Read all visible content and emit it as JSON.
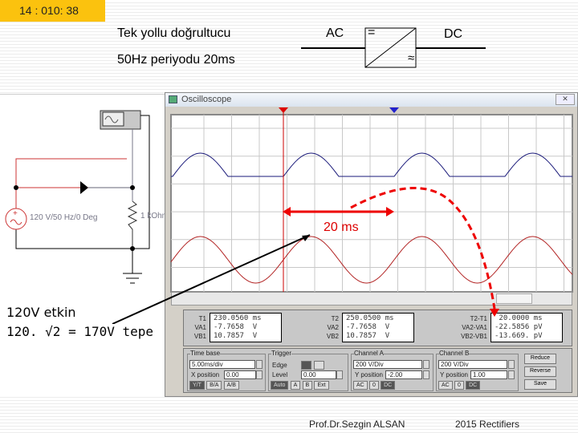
{
  "slide": {
    "number": "14 : 010: 38",
    "title": "Tek yollu doğrultucu",
    "subtitle": "50Hz periyodu 20ms",
    "ac_label": "AC",
    "dc_label": "DC",
    "dc_symbol": "=",
    "ac_symbol": "≈"
  },
  "circuit": {
    "source_label": "120 V/50 Hz/0 Deg",
    "resistor_label": "1 kOhm"
  },
  "notes": {
    "rms": "120V etkin",
    "peak": "120. √2 = 170V tepe",
    "period_label": "20 ms"
  },
  "oscilloscope": {
    "title": "Oscilloscope",
    "close": "✕",
    "cursor1": "1",
    "cursor2": "2",
    "measurements": [
      {
        "labels": [
          "T1",
          "VA1",
          "VB1"
        ],
        "values": [
          "230.0560 ms",
          "-7.7658  V",
          "10.7857  V"
        ]
      },
      {
        "labels": [
          "T2",
          "VA2",
          "VB2"
        ],
        "values": [
          "250.0500 ms",
          "-7.7658  V",
          "10.7857  V"
        ]
      },
      {
        "labels": [
          "T2-T1",
          "VA2-VA1",
          "VB2-VB1"
        ],
        "values": [
          " 20.0000 ms",
          "-22.5856 pV",
          "-13.669. pV"
        ]
      }
    ],
    "timebase": {
      "title": "Time base",
      "scale": "5.00ms/div",
      "xpos_label": "X position",
      "xpos": "0.00",
      "buttons": [
        "Y/T",
        "B/A",
        "A/B"
      ]
    },
    "trigger": {
      "title": "Trigger",
      "edge_label": "Edge",
      "level_label": "Level",
      "level": "0.00",
      "buttons": [
        "Auto",
        "A",
        "B",
        "Ext"
      ]
    },
    "channel_a": {
      "title": "Channel A",
      "scale": "200 V/Div",
      "ypos_label": "Y position",
      "ypos": "-2.00",
      "buttons": [
        "AC",
        "0",
        "DC"
      ]
    },
    "channel_b": {
      "title": "Channel B",
      "scale": "200 V/Div",
      "ypos_label": "Y position",
      "ypos": "1.00",
      "buttons": [
        "AC",
        "0",
        "DC"
      ]
    },
    "actions": [
      "Reduce",
      "Reverse",
      "Save"
    ],
    "colors": {
      "channel_a": "#b22222",
      "channel_b": "#1a1a7a",
      "annotation": "#e00000"
    }
  },
  "footer": {
    "author": "Prof.Dr.Sezgin ALSAN",
    "course": "2015 Rectifiers"
  }
}
